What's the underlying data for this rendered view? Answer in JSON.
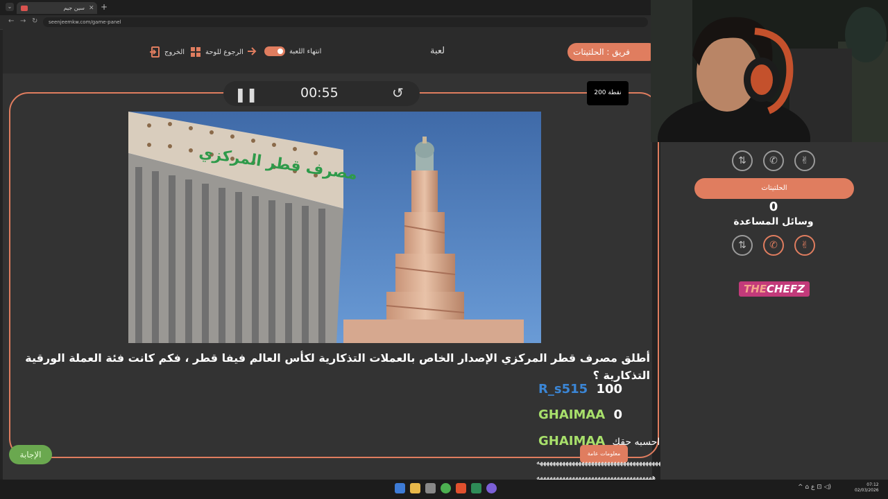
{
  "browser": {
    "tab_title": "سين جيم",
    "new_tab": "+",
    "url": "seenjeemkw.com/game-panel"
  },
  "header": {
    "team_label": "فريق : الحلتيتات",
    "game_label": "لعبة",
    "end_game": "انتهاء اللعبة",
    "back_to_board": "الرجوع للوحة",
    "exit": "الخروج"
  },
  "question_panel": {
    "timer": "00:55",
    "points": "200 نقطة",
    "question_text": "أطلق مصرف قطر المركزي الإصدار الخاص بالعملات التذكارية لكأس العالم فيفا قطر ، فكم كانت فئة العملة الورقية التذكارية ؟",
    "image_sign_text": "مصرف قطر المركزي",
    "answer_button": "الإجابة",
    "category_pill": "معلومات عامة"
  },
  "chat": [
    {
      "user": "R_s515",
      "message": "100",
      "color": "#3b86d6"
    },
    {
      "user": "GHAIMAA",
      "message": "0",
      "color": "#a8e06b"
    },
    {
      "user": "GHAIMAA",
      "message": "احسبه حقك",
      "color": "#a8e06b"
    }
  ],
  "chat_spam": [
    "ههههههههههههههههههههههههههههههههههههههههههههههههههههههه",
    "ههههههههههههههههههههههههههههههههههههه"
  ],
  "team2": {
    "name": "الحلتيتات",
    "score": "0",
    "help_label": "وسائل المساعدة"
  },
  "brand": {
    "chefz_a": "THE",
    "chefz_b": "CHEFZ"
  },
  "taskbar": {
    "clock_time": "07:12",
    "clock_date": "02/03/2026",
    "tray_text": "^ ⌂ ع ⊡ ◁)"
  },
  "colors": {
    "accent": "#e07d5f",
    "answer_green": "#6aa84f",
    "chefz_pink": "#c23a7a"
  }
}
